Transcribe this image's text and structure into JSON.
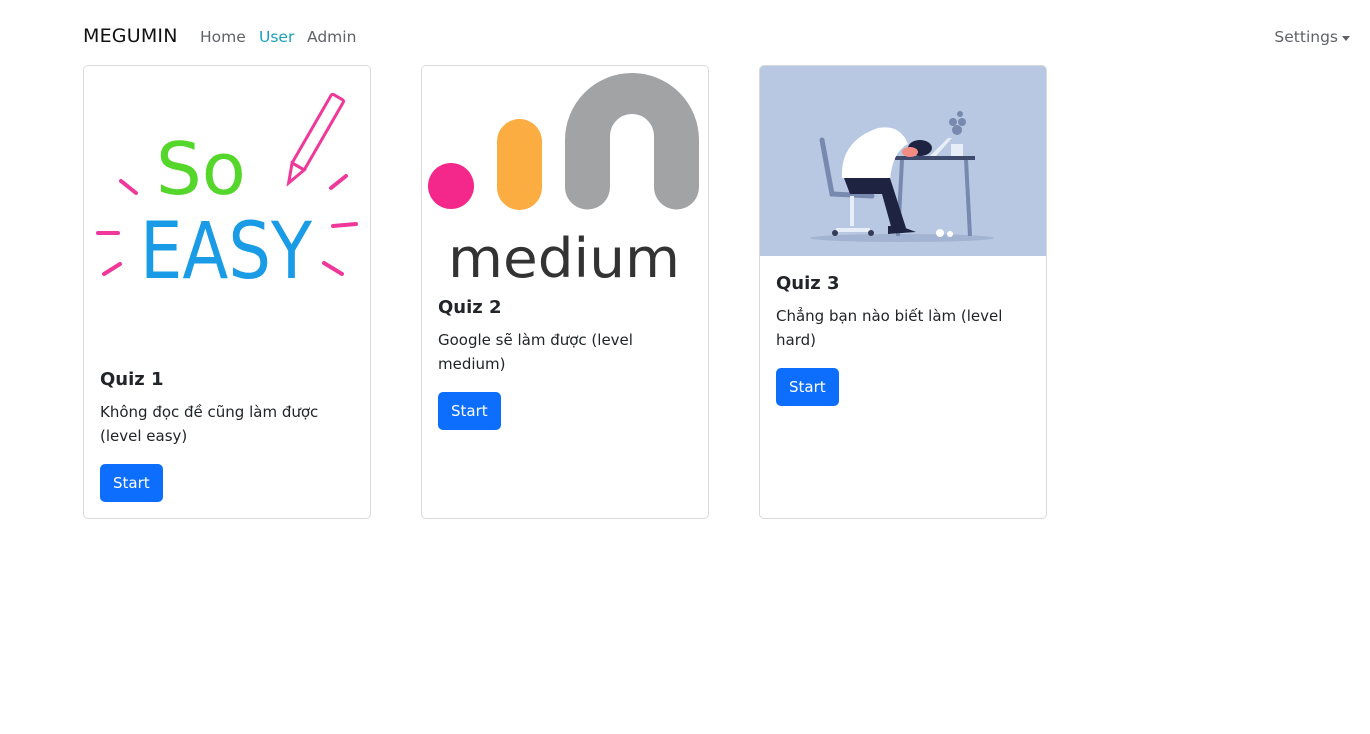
{
  "navbar": {
    "brand": "MEGUMIN",
    "links": [
      {
        "label": "Home"
      },
      {
        "label": "User"
      },
      {
        "label": "Admin"
      }
    ],
    "settings_label": "Settings"
  },
  "quizzes": [
    {
      "title": "Quiz 1",
      "description": "Không đọc đề cũng làm được (level easy)",
      "button_label": "Start",
      "image": {
        "icon": "so-easy-illustration",
        "lines": [
          "So",
          "EASY"
        ],
        "colors": {
          "so": "#55d62a",
          "easy": "#1a9be6",
          "pencil": "#f0389a"
        }
      }
    },
    {
      "title": "Quiz 2",
      "description": "Google sẽ làm được (level medium)",
      "button_label": "Start",
      "image": {
        "icon": "medium-logo",
        "word": "medium",
        "colors": {
          "dot": "#f4288a",
          "pill": "#fbad42",
          "arch": "#a2a3a5"
        }
      }
    },
    {
      "title": "Quiz 3",
      "description": "Chẳng bạn nào biết làm (level hard)",
      "button_label": "Start",
      "image": {
        "icon": "tired-person-at-desk-illustration",
        "colors": {
          "background": "#b8c8e2"
        }
      }
    }
  ],
  "colors": {
    "primary": "#0d6efd",
    "active_link": "#17a2b8"
  }
}
